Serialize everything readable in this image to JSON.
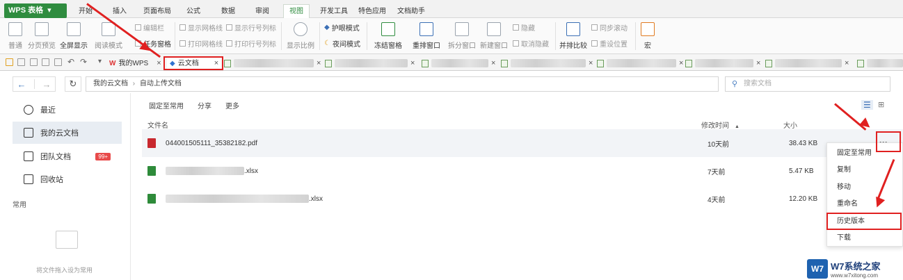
{
  "app": {
    "logo_text": "WPS 表格"
  },
  "menubar": {
    "items": [
      "开始",
      "插入",
      "页面布局",
      "公式",
      "数据",
      "审阅",
      "视图",
      "开发工具",
      "特色应用",
      "文档助手"
    ],
    "active": "视图"
  },
  "ribbon": {
    "normal": "普通",
    "page_preview": "分页预览",
    "fullscreen": "全屏显示",
    "reading_mode": "阅读模式",
    "edit_bar": "编辑栏",
    "task_pane": "任务窗格",
    "show_gridlines": "显示网格线",
    "show_row_col_headers": "显示行号列标",
    "print_gridlines": "打印网格线",
    "print_row_col_headers": "打印行号列标",
    "zoom": "显示比例",
    "eye_protection": "护眼模式",
    "night_mode": "夜间模式",
    "freeze_panes": "冻结窗格",
    "rearrange_windows": "重排窗口",
    "split_window": "拆分窗口",
    "new_window": "新建窗口",
    "hide": "隐藏",
    "unhide": "取消隐藏",
    "side_by_side": "并排比较",
    "sync_scroll": "同步滚动",
    "reset_position": "重设位置",
    "macro": "宏"
  },
  "tabs": {
    "my_wps": "我的WPS",
    "cloud_docs": "云文档",
    "close_glyph": "×"
  },
  "nav": {
    "breadcrumb_root": "我的云文档",
    "breadcrumb_sep": "›",
    "breadcrumb_current": "自动上传文档",
    "search_placeholder": "搜索文档",
    "back": "←",
    "forward": "→",
    "refresh": "↻"
  },
  "sidebar": {
    "items": [
      {
        "label": "最近"
      },
      {
        "label": "我的云文档"
      },
      {
        "label": "团队文档",
        "badge": "99+"
      },
      {
        "label": "回收站"
      }
    ],
    "section_label": "常用",
    "drop_hint": "将文件拖入设为常用"
  },
  "main": {
    "actions": [
      "固定至常用",
      "分享",
      "更多"
    ],
    "columns": {
      "name": "文件名",
      "modified": "修改时间",
      "sort_glyph": "▲",
      "size": "大小"
    },
    "files": [
      {
        "name": "044001505111_35382182.pdf",
        "modified": "10天前",
        "size": "38.43 KB",
        "type": "pdf"
      },
      {
        "name": ".xlsx",
        "modified": "7天前",
        "size": "5.47 KB",
        "type": "xlsx"
      },
      {
        "name": ".xlsx",
        "modified": "4天前",
        "size": "12.20 KB",
        "type": "xlsx"
      }
    ],
    "more_glyph": "···"
  },
  "context_menu": {
    "items": [
      "固定至常用",
      "复制",
      "移动",
      "重命名",
      "历史版本",
      "下载"
    ]
  },
  "watermark": {
    "logo": "W7",
    "title": "W7系统之家",
    "url": "www.w7xitong.com"
  },
  "colors": {
    "wps_green": "#2f8c3f",
    "annotation_red": "#e02020",
    "pdf_red": "#c8282e",
    "xlsx_green": "#2e8b3a"
  }
}
